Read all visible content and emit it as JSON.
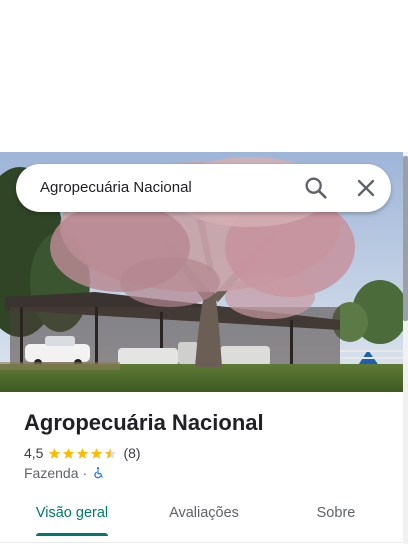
{
  "search": {
    "query": "Agropecuária Nacional",
    "search_icon": "search-icon",
    "close_icon": "close-icon"
  },
  "place": {
    "name": "Agropecuária Nacional",
    "rating": "4,5",
    "stars": 4.5,
    "reviews": "(8)",
    "category": "Fazenda",
    "separator": "·",
    "accessibility_icon": "wheelchair-icon"
  },
  "tabs": [
    {
      "label": "Visão geral",
      "active": true
    },
    {
      "label": "Avaliações",
      "active": false
    },
    {
      "label": "Sobre",
      "active": false
    }
  ],
  "colors": {
    "accent": "#00796b",
    "star": "#fbbc04",
    "access_icon": "#1a73e8"
  }
}
